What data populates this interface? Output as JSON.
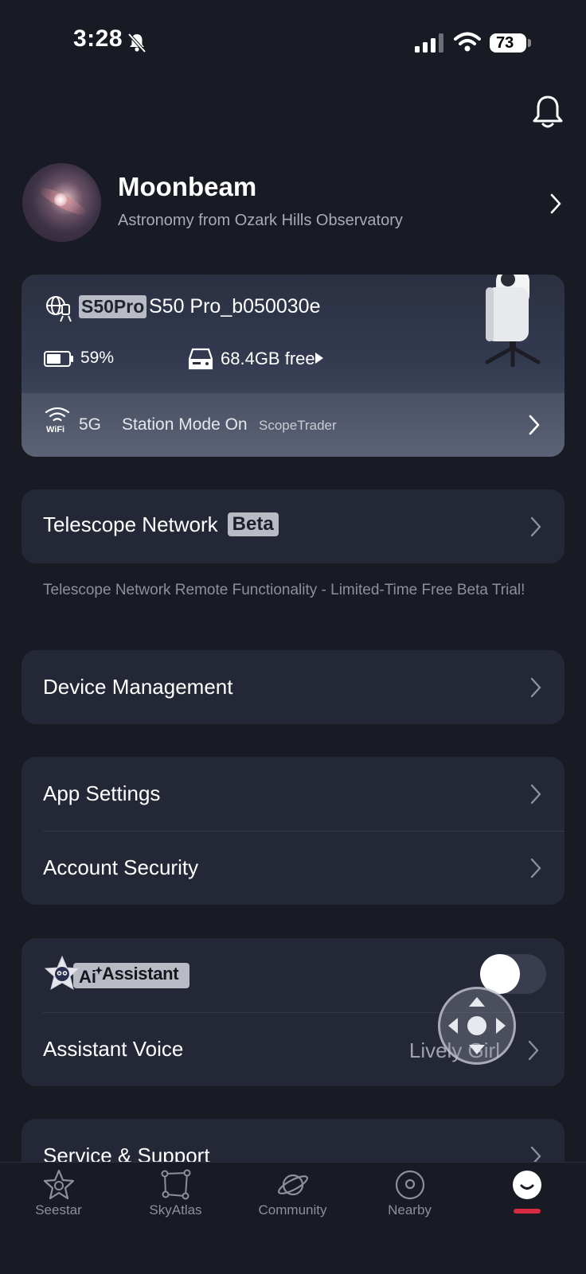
{
  "status_bar": {
    "time": "3:28",
    "battery": "73"
  },
  "profile": {
    "name": "Moonbeam",
    "subtitle": "Astronomy from Ozark Hills Observatory"
  },
  "device": {
    "model_badge": "S50Pro",
    "name": "S50 Pro_b050030e",
    "battery": "59%",
    "storage": "68.4GB free",
    "wifi_icon_label": "WiFi",
    "band": "5G",
    "station_mode": "Station Mode On",
    "ssid": "ScopeTrader"
  },
  "menu": {
    "telescope_network": "Telescope Network",
    "beta_badge": "Beta",
    "telescope_network_note": "Telescope Network Remote Functionality - Limited-Time Free Beta Trial!",
    "device_management": "Device Management",
    "app_settings": "App Settings",
    "account_security": "Account Security",
    "ai_assistant_label": "Assistant",
    "ai_assistant_enabled": true,
    "assistant_voice": "Assistant Voice",
    "assistant_voice_value": "Lively Girl",
    "service_support": "Service & Support"
  },
  "tabbar": {
    "tabs": [
      {
        "label": "Seestar",
        "icon": "seestar-icon",
        "active": false
      },
      {
        "label": "SkyAtlas",
        "icon": "skyatlas-icon",
        "active": false
      },
      {
        "label": "Community",
        "icon": "planet-icon",
        "active": false
      },
      {
        "label": "Nearby",
        "icon": "location-icon",
        "active": false
      },
      {
        "label": "",
        "icon": "profile-face-icon",
        "active": true
      }
    ]
  },
  "colors": {
    "accent": "#d92a43",
    "background": "#181a24",
    "card": "#242735"
  }
}
